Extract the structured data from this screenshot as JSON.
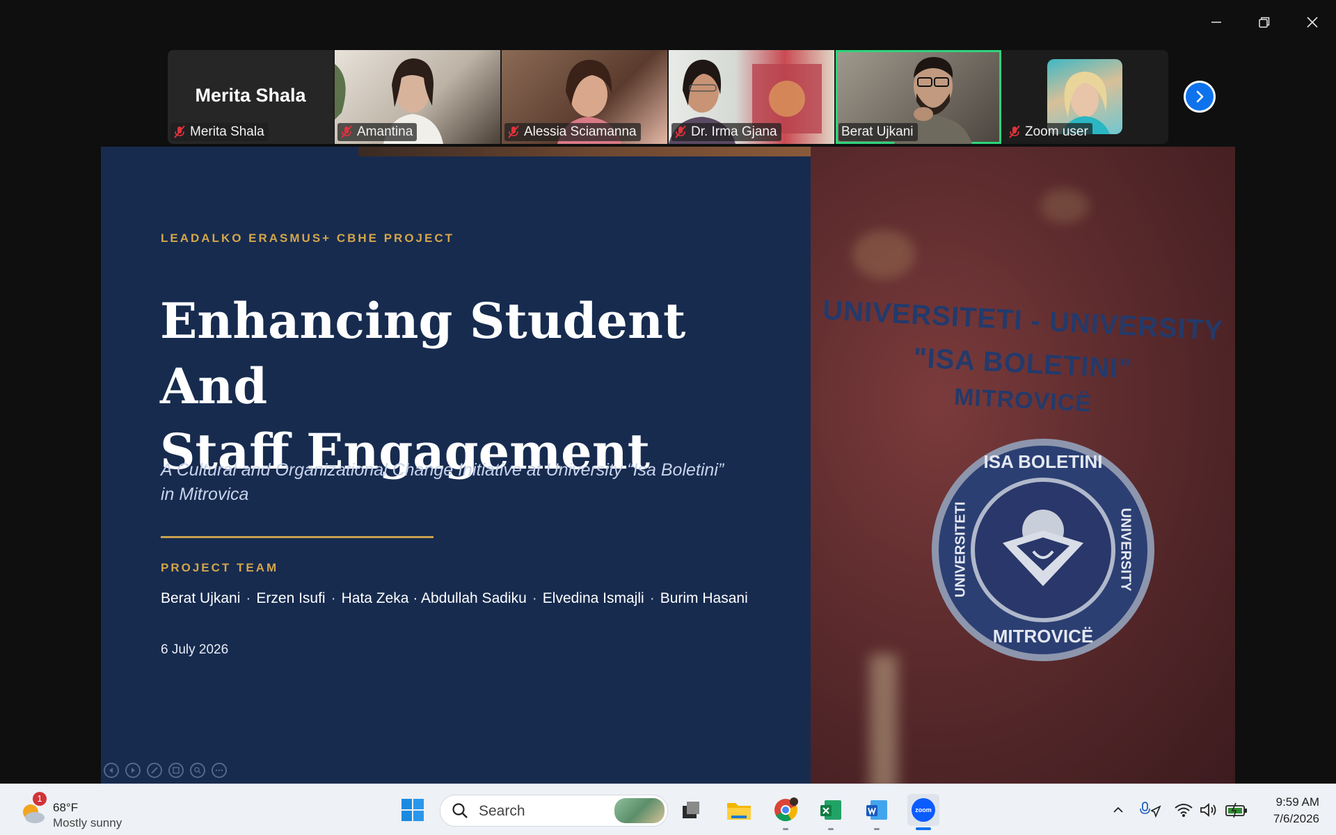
{
  "participants": [
    {
      "display": "Merita Shala",
      "label": "Merita Shala",
      "video": false,
      "muted": true
    },
    {
      "label": "Amantina",
      "video": true,
      "muted": true,
      "bg": "#cfc8bf"
    },
    {
      "label": "Alessia Sciamanna",
      "video": true,
      "muted": true,
      "bg": "#6b4a3a"
    },
    {
      "label": "Dr. Irma Gjana",
      "video": true,
      "muted": true,
      "bg": "#d9dcd8"
    },
    {
      "label": "Berat Ujkani",
      "video": true,
      "muted": false,
      "active": true,
      "bg": "#8a8478"
    },
    {
      "label": "Zoom user",
      "video": false,
      "muted": true
    }
  ],
  "slide": {
    "kicker": "LEADALKO ERASMUS+ CBHE PROJECT",
    "title_line1": "Enhancing Student And",
    "title_line2": "Staff Engagement",
    "subtitle_line1": "A Cultural and Organizational Change Initiative at University “Isa Boletini”",
    "subtitle_line2": "in Mitrovica",
    "team_label": "PROJECT TEAM",
    "team": [
      "Berat Ujkani",
      "Erzen Isufi",
      "Hata Zeka · Abdullah Sadiku",
      "Elvedina Ismajli",
      "Burim Hasani"
    ],
    "team_separator": "·",
    "date": "6 July 2026",
    "sign_line1": "UNIVERSITETI - UNIVERSITY",
    "sign_line2": "\"ISA BOLETINI\"",
    "sign_line3": "MITROVICË",
    "seal_top": "ISA BOLETINI",
    "seal_bottom": "MITROVICË",
    "seal_left": "UNIVERSITETI",
    "seal_right": "UNIVERSITY"
  },
  "taskbar": {
    "weather_temp": "68°F",
    "weather_condition": "Mostly sunny",
    "weather_badge": "1",
    "search_label": "Search",
    "time": "9:59 AM",
    "date": "7/6/2026"
  },
  "colors": {
    "slide_bg": "#172b4f",
    "accent_gold": "#d4a64a",
    "active_speaker": "#2ed47a",
    "zoom_blue": "#0e72ed"
  }
}
